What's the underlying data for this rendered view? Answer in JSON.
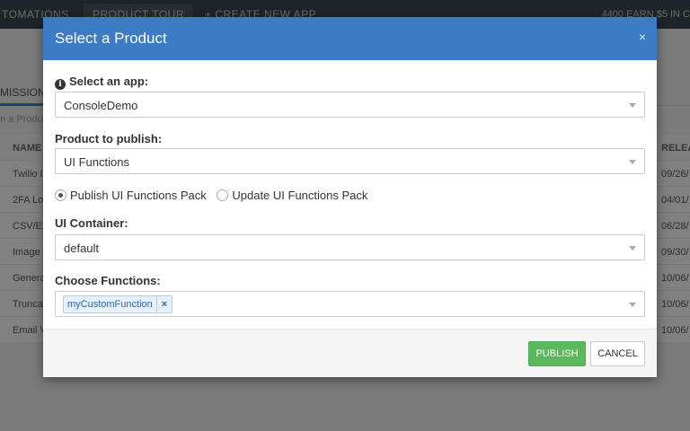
{
  "background": {
    "top_tabs": [
      "TOMATIONS",
      "PRODUCT TOUR",
      "+ CREATE NEW APP"
    ],
    "top_right": "4400 EARN $5 IN C",
    "section_tab": "MISSIONS",
    "search_hint": "n a Produc",
    "table": {
      "headers": [
        "NAME",
        "RELEA"
      ],
      "rows": [
        [
          "Twilio I",
          "09/26/"
        ],
        [
          "2FA Lo",
          "04/01/"
        ],
        [
          "CSV/Ex",
          "06/28/"
        ],
        [
          "Image",
          "09/30/"
        ],
        [
          "Genera",
          "10/06/"
        ],
        [
          "Trunca",
          "10/06/"
        ],
        [
          "Email V",
          "10/06/"
        ]
      ]
    }
  },
  "modal": {
    "title": "Select a Product",
    "close": "×",
    "app": {
      "label": "Select an app:",
      "value": "ConsoleDemo"
    },
    "product": {
      "label": "Product to publish:",
      "value": "UI Functions"
    },
    "pack_options": [
      {
        "label": "Publish UI Functions Pack",
        "checked": true
      },
      {
        "label": "Update UI Functions Pack",
        "checked": false
      }
    ],
    "container": {
      "label": "UI Container:",
      "value": "default"
    },
    "functions": {
      "label": "Choose Functions:",
      "tags": [
        "myCustomFunction"
      ],
      "remove_symbol": "×"
    },
    "buttons": {
      "publish": "PUBLISH",
      "cancel": "CANCEL"
    }
  },
  "colors": {
    "header": "#3c7bc5",
    "publish": "#5cb85c",
    "overlay": "rgba(0,0,0,0.48)"
  }
}
